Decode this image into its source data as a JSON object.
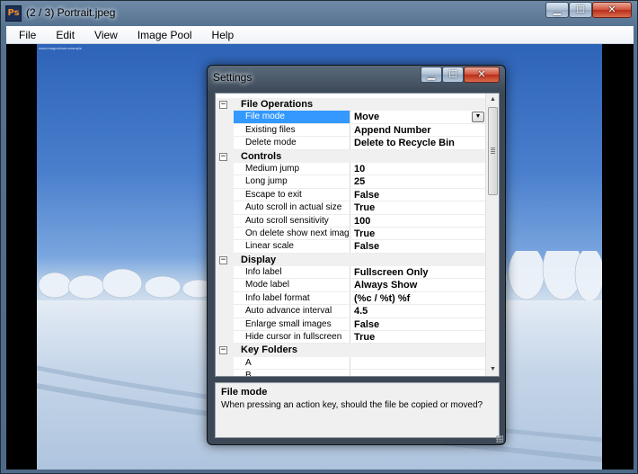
{
  "window": {
    "title": "(2 / 3) Portrait.jpeg",
    "icon_label": "Ps",
    "minimize_glyph": "▁",
    "maximize_glyph": "☐",
    "close_glyph": "✕"
  },
  "menu": [
    "File",
    "Edit",
    "View",
    "Image Pool",
    "Help"
  ],
  "photo": {
    "corner_text": "www.imageviewer.example"
  },
  "settings": {
    "title": "Settings",
    "categories": [
      {
        "name": "File Operations",
        "expander": "−",
        "props": [
          {
            "name": "File mode",
            "value": "Move",
            "selected": true,
            "dropdown": "▼"
          },
          {
            "name": "Existing files",
            "value": "Append Number"
          },
          {
            "name": "Delete mode",
            "value": "Delete to Recycle Bin"
          }
        ]
      },
      {
        "name": "Controls",
        "expander": "−",
        "props": [
          {
            "name": "Medium jump",
            "value": "10"
          },
          {
            "name": "Long jump",
            "value": "25"
          },
          {
            "name": "Escape to exit",
            "value": "False"
          },
          {
            "name": "Auto scroll in actual size",
            "value": "True"
          },
          {
            "name": "Auto scroll sensitivity",
            "value": "100"
          },
          {
            "name": "On delete show next image",
            "value": "True"
          },
          {
            "name": "Linear scale",
            "value": "False"
          }
        ]
      },
      {
        "name": "Display",
        "expander": "−",
        "props": [
          {
            "name": "Info label",
            "value": "Fullscreen Only"
          },
          {
            "name": "Mode label",
            "value": "Always Show"
          },
          {
            "name": "Info label format",
            "value": "(%c / %t) %f"
          },
          {
            "name": "Auto advance interval",
            "value": "4.5"
          },
          {
            "name": "Enlarge small images",
            "value": "False"
          },
          {
            "name": "Hide cursor in fullscreen",
            "value": "True"
          }
        ]
      },
      {
        "name": "Key Folders",
        "expander": "−",
        "props": [
          {
            "name": "A",
            "value": ""
          },
          {
            "name": "B",
            "value": ""
          }
        ]
      }
    ],
    "scroll": {
      "up": "▲",
      "down": "▼"
    },
    "description": {
      "title": "File mode",
      "text": "When pressing an action key, should the file be copied or moved?"
    }
  },
  "colors": {
    "selection": "#3399ff",
    "frame": "#4e6a88",
    "close_button": "#c8402a"
  }
}
